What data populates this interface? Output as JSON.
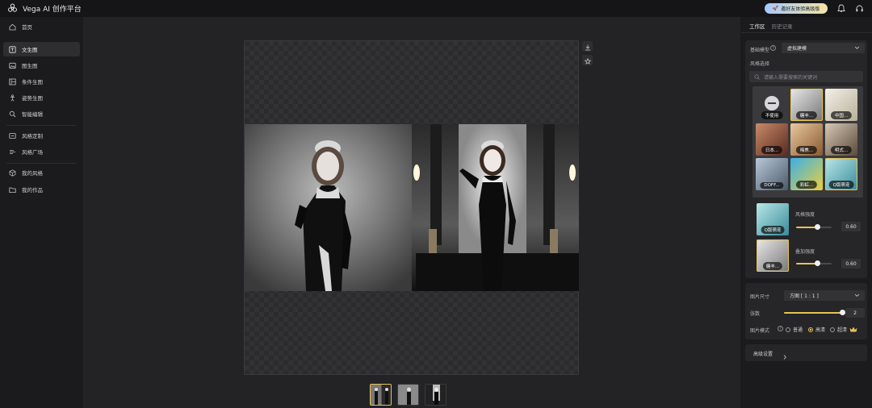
{
  "app": {
    "title": "Vega AI 创作平台",
    "invite_label": "邀好友体验高级版"
  },
  "sidebar": {
    "items": [
      {
        "label": "首页",
        "icon": "home-icon"
      },
      {
        "label": "文生图",
        "icon": "text-image-icon"
      },
      {
        "label": "图生图",
        "icon": "image-image-icon"
      },
      {
        "label": "条件生图",
        "icon": "condition-icon"
      },
      {
        "label": "姿势生图",
        "icon": "pose-icon"
      },
      {
        "label": "智能编辑",
        "icon": "edit-icon"
      },
      {
        "label": "风格定制",
        "icon": "style-custom-icon"
      },
      {
        "label": "风格广场",
        "icon": "style-square-icon"
      },
      {
        "label": "我的风格",
        "icon": "cube-icon"
      },
      {
        "label": "我的作品",
        "icon": "folder-icon"
      }
    ],
    "active_index": 1
  },
  "panel": {
    "tabs": [
      "工作区",
      "历史记录"
    ],
    "base_model_label": "基础模型",
    "base_model_value": "虚拟建模",
    "style_label": "风格选择",
    "search_placeholder": "请输入需要搜索的关键词",
    "style_tiles": [
      "不使用",
      "糖丰...",
      "中国...",
      "日本...",
      "梅焦...",
      "明式...",
      "DOFF...",
      "彩虹...",
      "Q版萌宠"
    ],
    "selected_styles": [
      {
        "name": "Q版萌宠",
        "strength_label": "风格强度",
        "value": "0.60",
        "level": 0.6
      },
      {
        "name": "糖丰...",
        "strength_label": "叠加强度",
        "value": "0.60",
        "level": 0.6
      }
    ],
    "size_label": "图片尺寸",
    "size_value": "方图 [ 1 : 1 ]",
    "count_label": "张数",
    "count_value": "2",
    "count_level": 1.0,
    "mode_label": "图片模式",
    "modes": [
      "普通",
      "高清",
      "超清"
    ],
    "mode_selected": "高清",
    "advanced_label": "高级设置"
  },
  "colors": {
    "accent": "#e8c254",
    "bg": "#1a1a1c",
    "panel": "#262628"
  }
}
